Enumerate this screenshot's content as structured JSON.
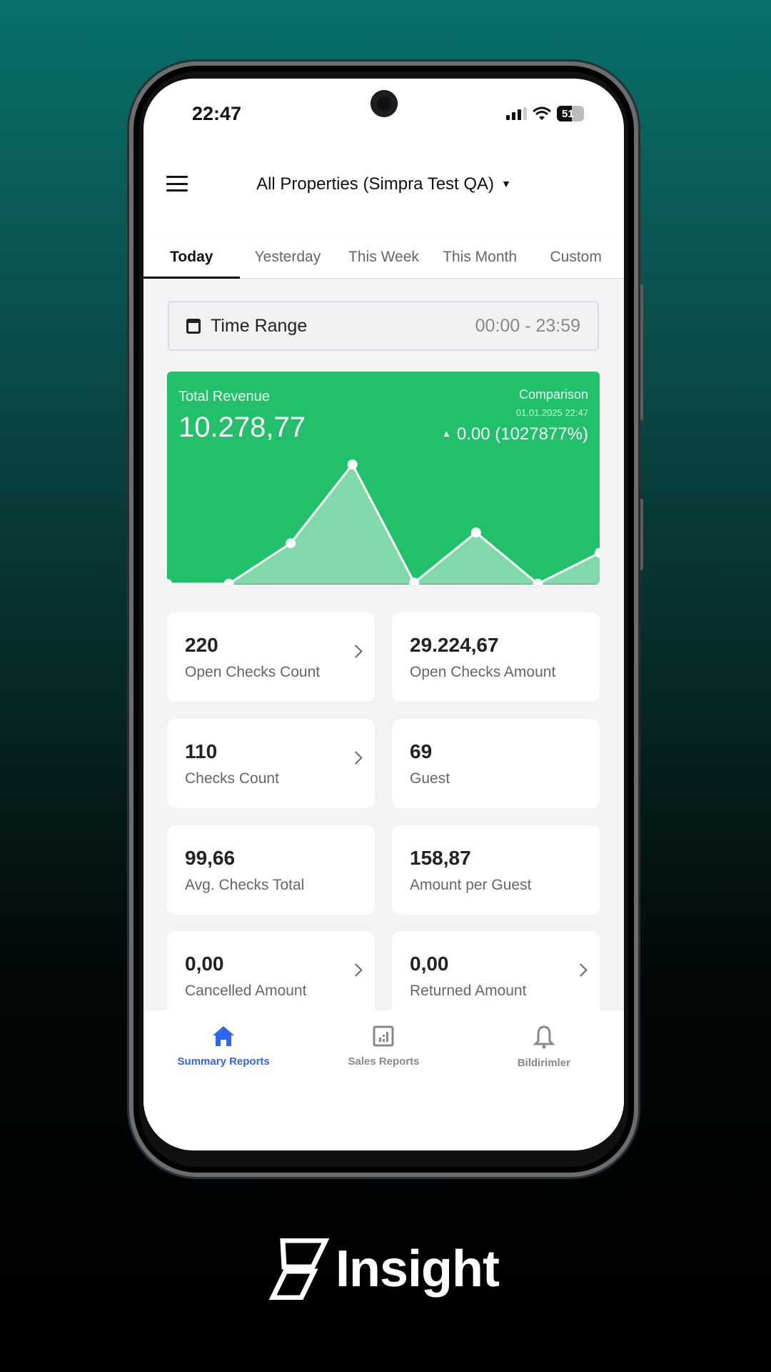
{
  "status_bar": {
    "time": "22:47",
    "battery": "51"
  },
  "header": {
    "property_selector": "All Properties (Simpra Test QA)"
  },
  "tabs": [
    {
      "label": "Today",
      "active": true
    },
    {
      "label": "Yesterday"
    },
    {
      "label": "This Week"
    },
    {
      "label": "This Month"
    },
    {
      "label": "Custom"
    }
  ],
  "time_range": {
    "label": "Time Range",
    "value": "00:00 - 23:59"
  },
  "revenue": {
    "title": "Total Revenue",
    "value": "10.278,77",
    "comparison_label": "Comparison",
    "comparison_date": "01.01.2025 22:47",
    "comparison_value": "0.00 (1027877%)",
    "color": "#22c06b"
  },
  "chart_data": {
    "type": "area",
    "values": [
      0,
      0,
      34,
      100,
      1,
      43,
      0,
      26
    ]
  },
  "cards": [
    {
      "value": "220",
      "label": "Open Checks Count",
      "chevron": true
    },
    {
      "value": "29.224,67",
      "label": "Open Checks Amount",
      "chevron": false
    },
    {
      "value": "110",
      "label": "Checks Count",
      "chevron": true
    },
    {
      "value": "69",
      "label": "Guest",
      "chevron": false
    },
    {
      "value": "99,66",
      "label": "Avg. Checks Total",
      "chevron": false
    },
    {
      "value": "158,87",
      "label": "Amount per Guest",
      "chevron": false
    },
    {
      "value": "0,00",
      "label": "Cancelled Amount",
      "chevron": true
    },
    {
      "value": "0,00",
      "label": "Returned Amount",
      "chevron": true
    }
  ],
  "bottom_nav": [
    {
      "label": "Summary Reports",
      "icon": "home-icon",
      "active": true,
      "color": "#2f66f0"
    },
    {
      "label": "Sales Reports",
      "icon": "report-chart-icon"
    },
    {
      "label": "Bildirimler",
      "icon": "bell-icon"
    }
  ],
  "brand": {
    "name": "Insight"
  }
}
